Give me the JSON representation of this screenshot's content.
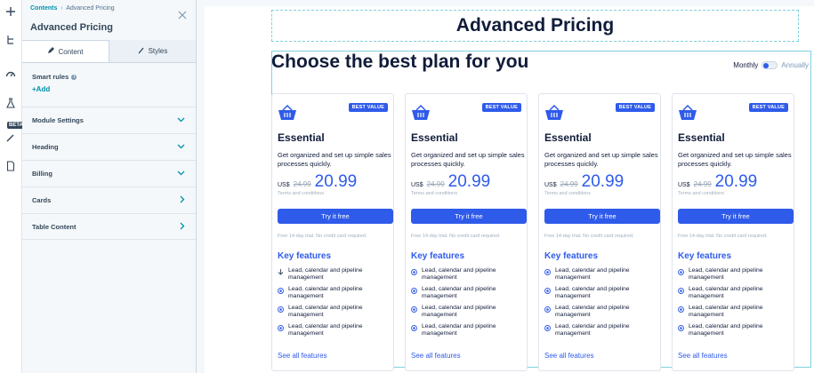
{
  "rail": {
    "beta_label": "BETA"
  },
  "panel": {
    "breadcrumb_root": "Contents",
    "breadcrumb_sep": "›",
    "breadcrumb_current": "Advanced Pricing",
    "title": "Advanced Pricing",
    "tabs": [
      {
        "label": "Content",
        "icon": "pencil-icon"
      },
      {
        "label": "Styles",
        "icon": "brush-icon"
      }
    ],
    "smart_rules_label": "Smart rules",
    "add_label": "+Add",
    "sections": [
      {
        "label": "Module Settings",
        "icon": "chevron-down-icon"
      },
      {
        "label": "Heading",
        "icon": "chevron-down-icon"
      },
      {
        "label": "Billing",
        "icon": "chevron-down-icon"
      },
      {
        "label": "Cards",
        "icon": "chevron-right-icon"
      },
      {
        "label": "Table Content",
        "icon": "chevron-right-icon"
      }
    ]
  },
  "page": {
    "heading": "Advanced Pricing",
    "subtitle": "Choose the best plan for you",
    "billing_monthly": "Monthly",
    "billing_annually": "Annually",
    "accent": "#2f5bea",
    "cards": [
      {
        "badge": "BEST VALUE",
        "plan": "Essential",
        "description": "Get organized and set up simple sales processes quickly.",
        "currency": "US$",
        "old_price": "24.99",
        "price": "20.99",
        "terms": "Terms and conditions",
        "cta": "Try it free",
        "trial": "Free 14-day trial. No credit card required.",
        "features_title": "Key features",
        "features": [
          {
            "text": "Lead, calendar and pipeline management",
            "icon": "arrow-down-icon"
          },
          {
            "text": "Lead, calendar and pipeline management",
            "icon": "radio-dot-icon"
          },
          {
            "text": "Lead, calendar and pipeline management",
            "icon": "radio-dot-icon"
          },
          {
            "text": "Lead, calendar and pipeline management",
            "icon": "radio-dot-icon"
          }
        ],
        "see_all": "See all features"
      },
      {
        "badge": "BEST VALUE",
        "plan": "Essential",
        "description": "Get organized and set up simple sales processes quickly.",
        "currency": "US$",
        "old_price": "24.99",
        "price": "20.99",
        "terms": "Terms and conditions",
        "cta": "Try it free",
        "trial": "Free 14-day trial. No credit card required.",
        "features_title": "Key features",
        "features": [
          {
            "text": "Lead, calendar and pipeline management",
            "icon": "radio-dot-icon"
          },
          {
            "text": "Lead, calendar and pipeline management",
            "icon": "radio-dot-icon"
          },
          {
            "text": "Lead, calendar and pipeline management",
            "icon": "radio-dot-icon"
          },
          {
            "text": "Lead, calendar and pipeline management",
            "icon": "radio-dot-icon"
          }
        ],
        "see_all": "See all features"
      },
      {
        "badge": "BEST VALUE",
        "plan": "Essential",
        "description": "Get organized and set up simple sales processes quickly.",
        "currency": "US$",
        "old_price": "24.99",
        "price": "20.99",
        "terms": "Terms and conditions",
        "cta": "Try it free",
        "trial": "Free 14-day trial. No credit card required.",
        "features_title": "Key features",
        "features": [
          {
            "text": "Lead, calendar and pipeline management",
            "icon": "radio-dot-icon"
          },
          {
            "text": "Lead, calendar and pipeline management",
            "icon": "radio-dot-icon"
          },
          {
            "text": "Lead, calendar and pipeline management",
            "icon": "radio-dot-icon"
          },
          {
            "text": "Lead, calendar and pipeline management",
            "icon": "radio-dot-icon"
          }
        ],
        "see_all": "See all features"
      },
      {
        "badge": "BEST VALUE",
        "plan": "Essential",
        "description": "Get organized and set up simple sales processes quickly.",
        "currency": "US$",
        "old_price": "24.99",
        "price": "20.99",
        "terms": "Terms and conditions",
        "cta": "Try it free",
        "trial": "Free 14-day trial. No credit card required.",
        "features_title": "Key features",
        "features": [
          {
            "text": "Lead, calendar and pipeline management",
            "icon": "radio-dot-icon"
          },
          {
            "text": "Lead, calendar and pipeline management",
            "icon": "radio-dot-icon"
          },
          {
            "text": "Lead, calendar and pipeline management",
            "icon": "radio-dot-icon"
          },
          {
            "text": "Lead, calendar and pipeline management",
            "icon": "radio-dot-icon"
          }
        ],
        "see_all": "See all features"
      }
    ]
  }
}
